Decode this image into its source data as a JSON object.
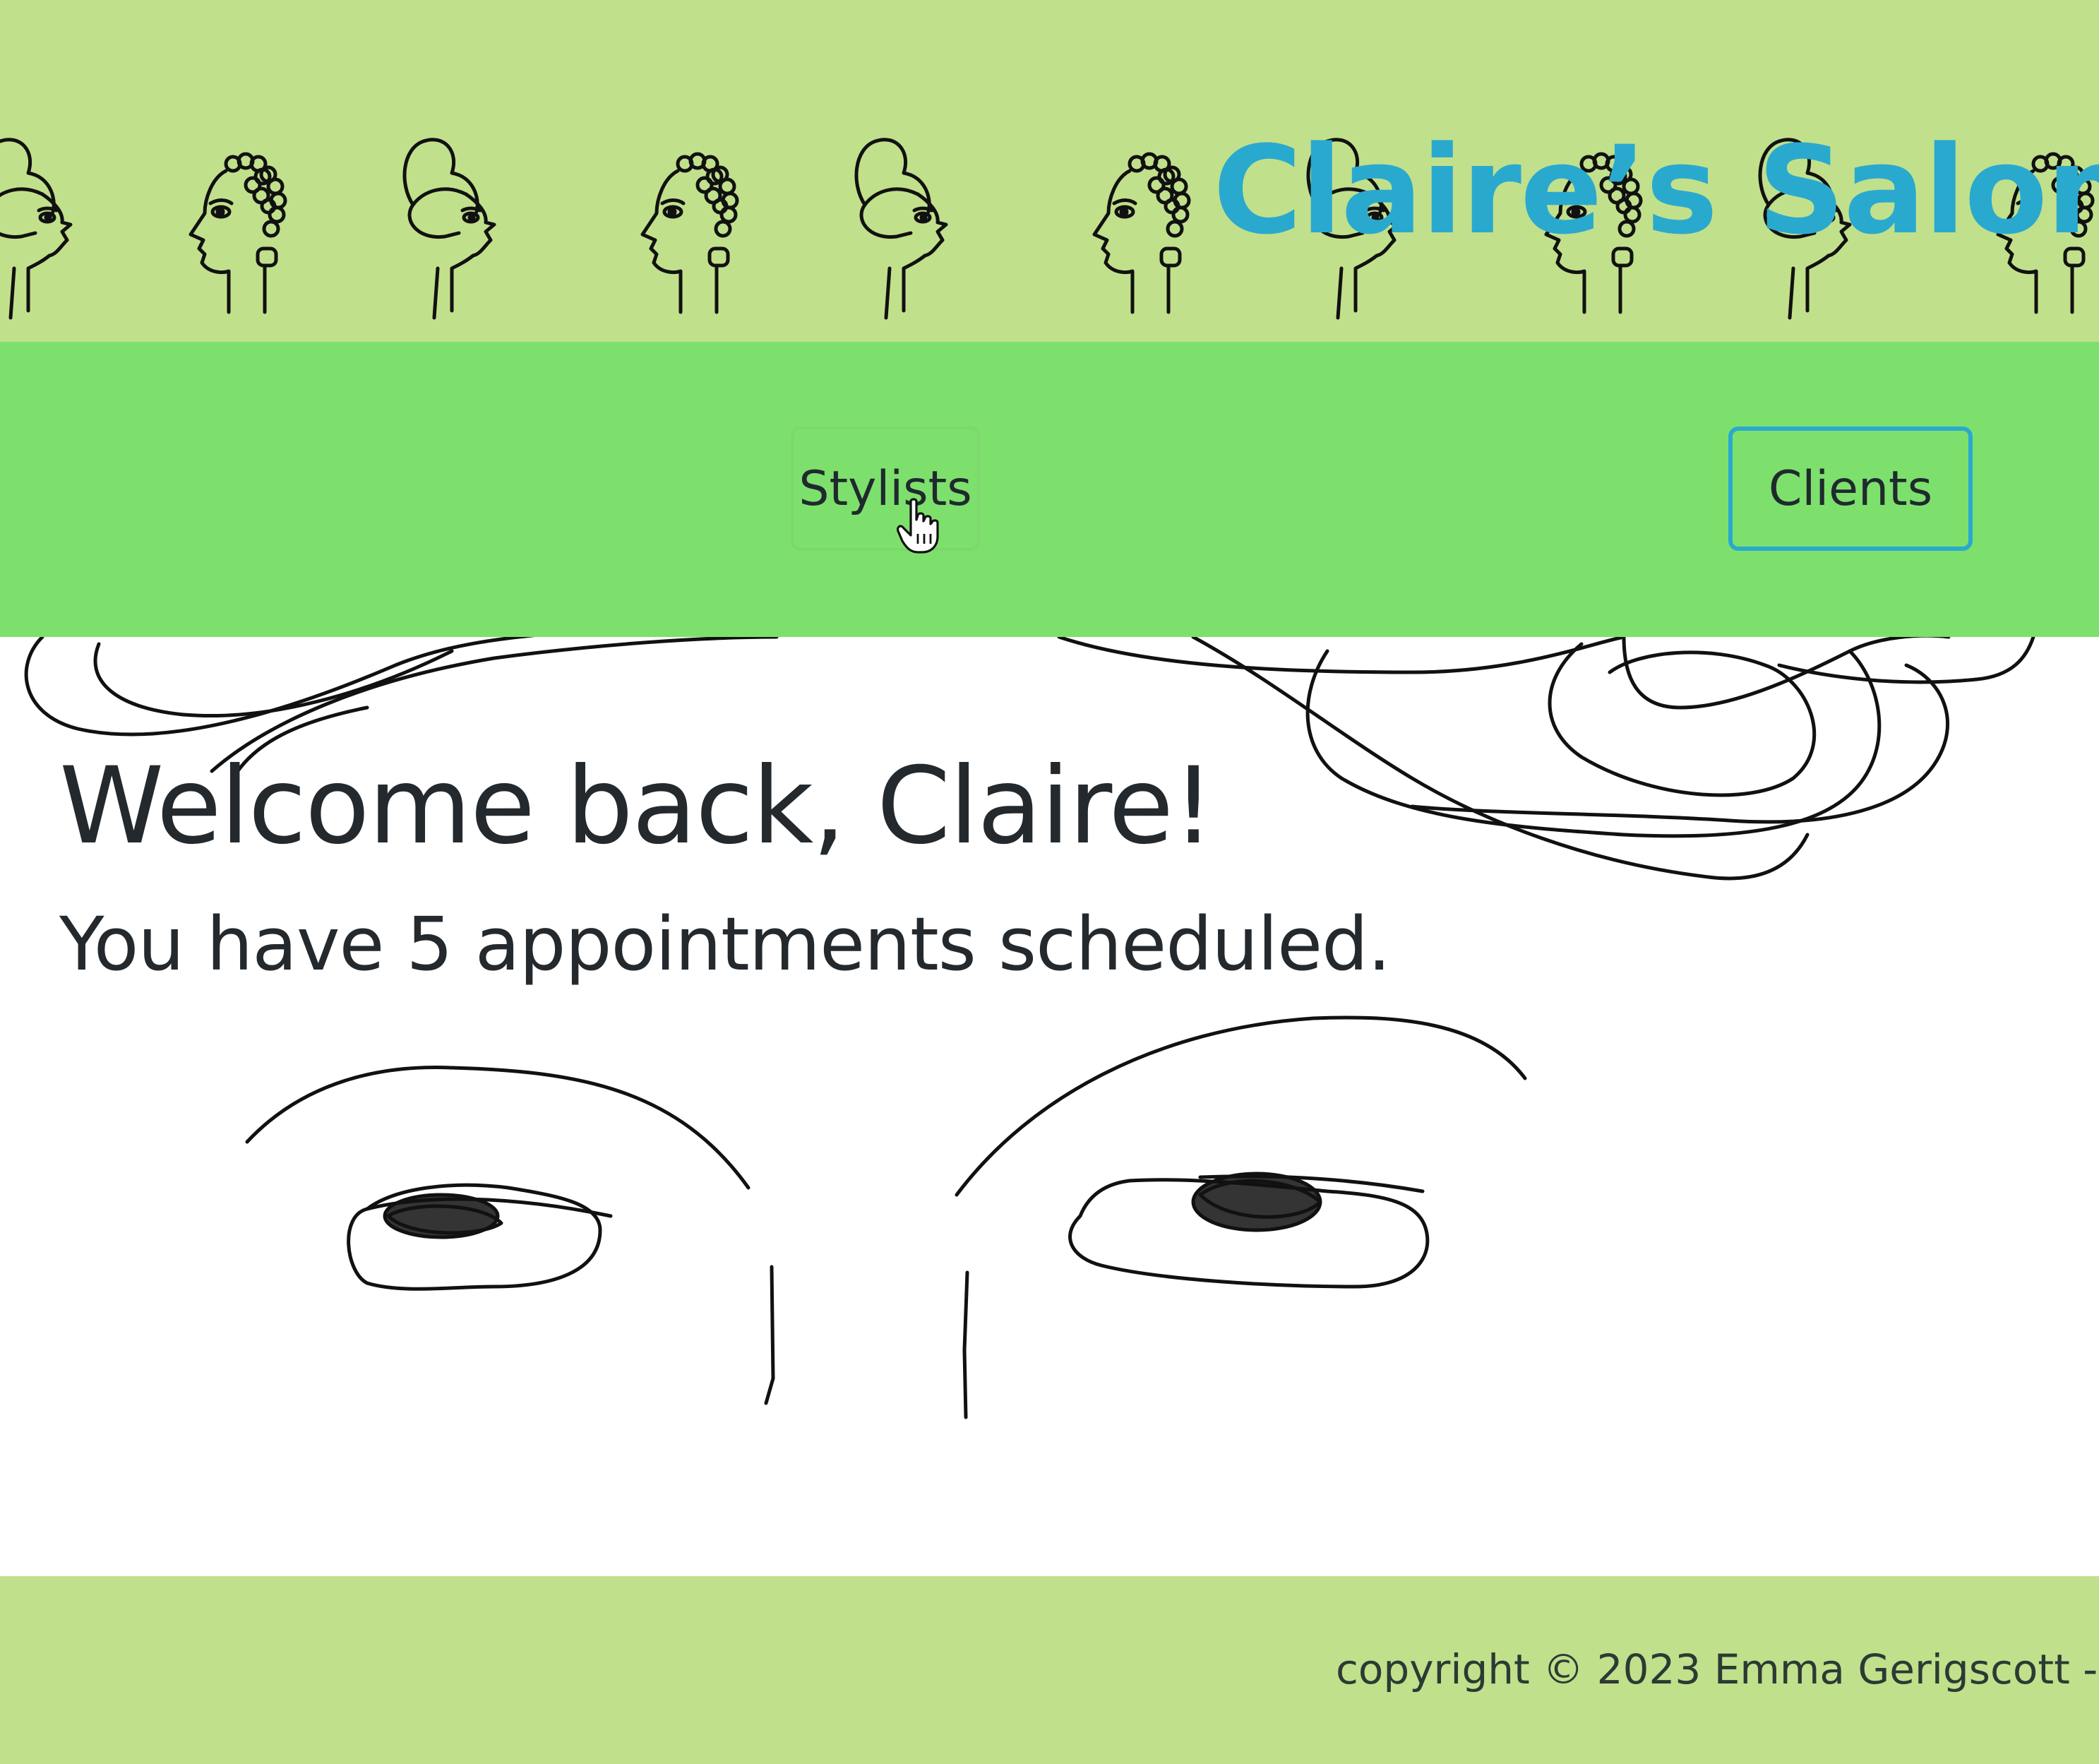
{
  "header": {
    "site_title": "Claire’s Salon",
    "title_color": "#2aa9cf",
    "background_color": "#c1e08b",
    "decoration_icon": "line-drawn-salon-heads"
  },
  "nav": {
    "background_color": "#7ee06c",
    "stylists_label": "Stylists",
    "clients_label": "Clients",
    "cursor_icon": "hand-pointer-icon"
  },
  "main": {
    "welcome_title": "Welcome back, Claire!",
    "appointments_text": "You have 5 appointments scheduled.",
    "decoration_icon": "line-drawn-face"
  },
  "footer": {
    "copyright": "copyright © 2023 Emma Gerigscott -"
  }
}
